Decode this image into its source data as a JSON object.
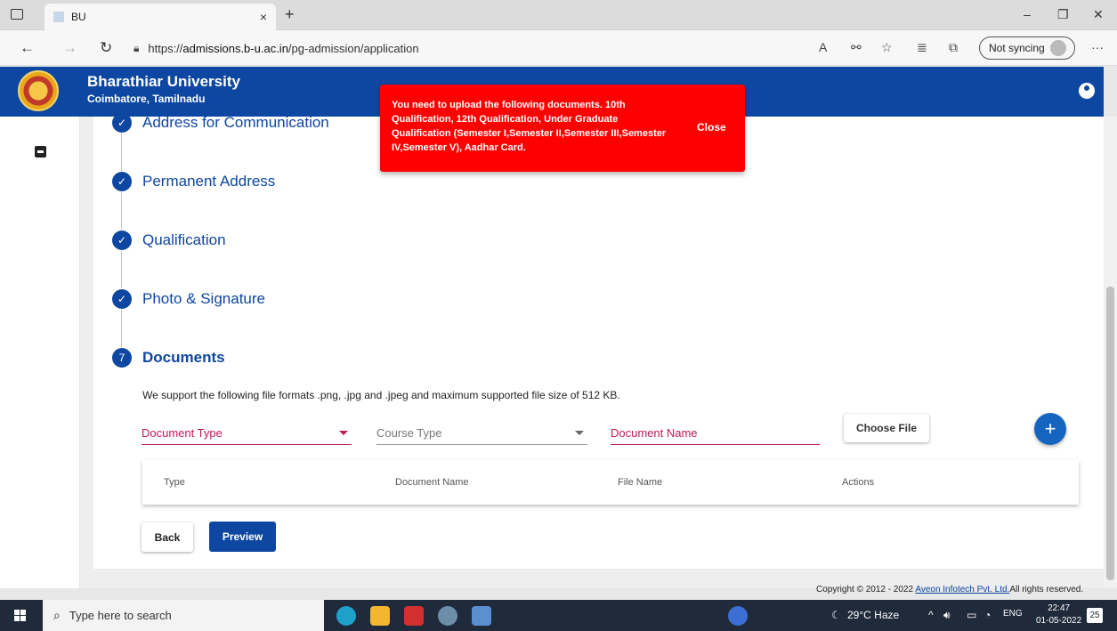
{
  "browser": {
    "tab_title": "BU",
    "tab_close": "×",
    "new_tab": "+",
    "url_prefix": "https://",
    "url_host": "admissions.b-u.ac.in",
    "url_path": "/pg-admission/application",
    "sync_label": "Not syncing",
    "more": "···"
  },
  "header": {
    "university": "Bharathiar University",
    "location": "Coimbatore, Tamilnadu"
  },
  "steps": [
    {
      "label": "Address for Communication",
      "marker": "✓"
    },
    {
      "label": "Permanent Address",
      "marker": "✓"
    },
    {
      "label": "Qualification",
      "marker": "✓"
    },
    {
      "label": "Photo & Signature",
      "marker": "✓"
    },
    {
      "label": "Documents",
      "marker": "7"
    }
  ],
  "documents": {
    "info": "We support the following file formats .png, .jpg and .jpeg and maximum supported file size of 512 KB.",
    "document_type_label": "Document Type",
    "course_type_label": "Course Type",
    "document_name_label": "Document Name",
    "choose_file": "Choose File",
    "add": "+",
    "table_headers": [
      "Type",
      "Document Name",
      "File Name",
      "Actions"
    ],
    "back": "Back",
    "preview": "Preview"
  },
  "footer": {
    "prefix": "Copyright © 2012 - 2022 ",
    "company": "Aveon Infotech Pvt. Ltd.",
    "suffix": "All rights reserved."
  },
  "toast": {
    "message": "You need to upload the following documents. 10th Qualification, 12th Qualification, Under Graduate Qualification (Semester I,Semester II,Semester III,Semester IV,Semester V), Aadhar Card.",
    "close": "Close"
  },
  "taskbar": {
    "search_placeholder": "Type here to search",
    "weather": "29°C  Haze",
    "lang": "ENG",
    "time": "22:47",
    "date": "01-05-2022",
    "notifications": "25"
  },
  "colors": {
    "brand": "#0d47a1",
    "accent_pink": "#c2185b",
    "toast_bg": "#ff0000"
  }
}
